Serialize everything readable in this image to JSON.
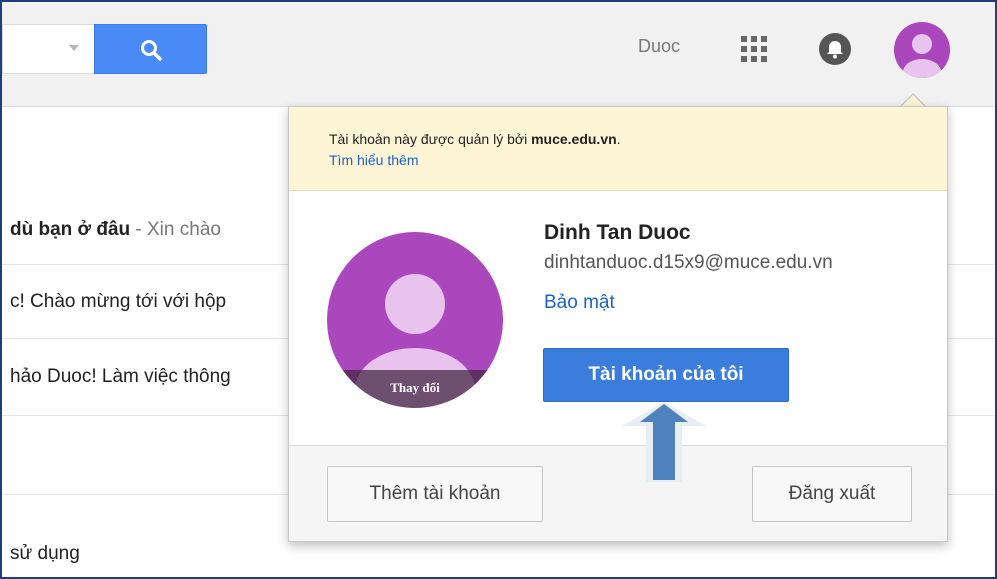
{
  "header": {
    "user_name": "Duoc",
    "icons": [
      "search-icon",
      "apps-grid-icon",
      "notifications-bell-icon",
      "avatar-icon"
    ]
  },
  "mail_rows": [
    {
      "bold": "dù bạn ở đâu",
      "rest": " - Xin chào"
    },
    {
      "bold": "",
      "rest": "c! Chào mừng tới với hộp"
    },
    {
      "bold": "",
      "rest": "hảo Duoc! Làm việc thông"
    },
    {
      "bold": "",
      "rest": "sử dụng"
    }
  ],
  "account_popup": {
    "notice_text": "Tài khoản này được quản lý bởi ",
    "notice_domain": "muce.edu.vn",
    "notice_suffix": ".",
    "learn_more": "Tìm hiểu thêm",
    "change_photo": "Thay đổi",
    "name": "Dinh Tan Duoc",
    "email": "dinhtanduoc.d15x9@muce.edu.vn",
    "security_link": "Bảo mật",
    "my_account_button": "Tài khoản của tôi",
    "add_account_button": "Thêm tài khoản",
    "sign_out_button": "Đăng xuất"
  },
  "colors": {
    "accent_blue": "#4a8af4",
    "avatar_purple": "#ab47bc",
    "notice_bg": "#fdf5d6",
    "annotation_arrow": "#4f81bd"
  }
}
